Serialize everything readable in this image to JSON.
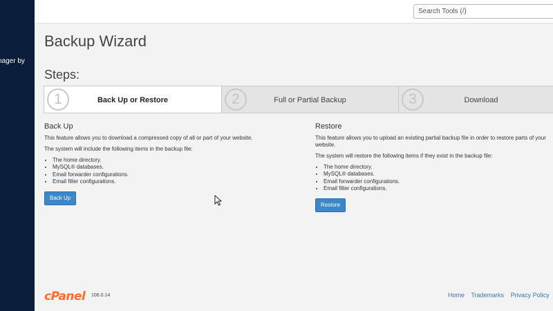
{
  "sidebar": {
    "text": "nager by"
  },
  "search": {
    "placeholder": "Search Tools (/)"
  },
  "page": {
    "title": "Backup Wizard",
    "steps_heading": "Steps:"
  },
  "steps": [
    {
      "num": "1",
      "label": "Back Up or Restore",
      "active": true
    },
    {
      "num": "2",
      "label": "Full or Partial Backup",
      "active": false
    },
    {
      "num": "3",
      "label": "Download",
      "active": false
    }
  ],
  "backup": {
    "heading": "Back Up",
    "desc": "This feature allows you to download a compressed copy of all or part of your website.",
    "intro": "The system will include the following items in the backup file:",
    "items": [
      "The home directory.",
      "MySQL® databases.",
      "Email forwarder configurations.",
      "Email filter configurations."
    ],
    "button": "Back Up"
  },
  "restore": {
    "heading": "Restore",
    "desc": "This feature allows you to upload an existing partial backup file in order to restore parts of your website.",
    "intro": "The system will restore the following items if they exist in the backup file:",
    "items": [
      "The home directory.",
      "MySQL® databases.",
      "Email forwarder configurations.",
      "Email filter configurations."
    ],
    "button": "Restore"
  },
  "footer": {
    "logo": "cPanel",
    "version": "106.0.14",
    "links": [
      "Home",
      "Trademarks",
      "Privacy Policy"
    ]
  },
  "colors": {
    "sidebar": "#0a1e3c",
    "accent": "#3b87c9",
    "logo": "#ff6c2c",
    "link": "#3b76b8"
  }
}
